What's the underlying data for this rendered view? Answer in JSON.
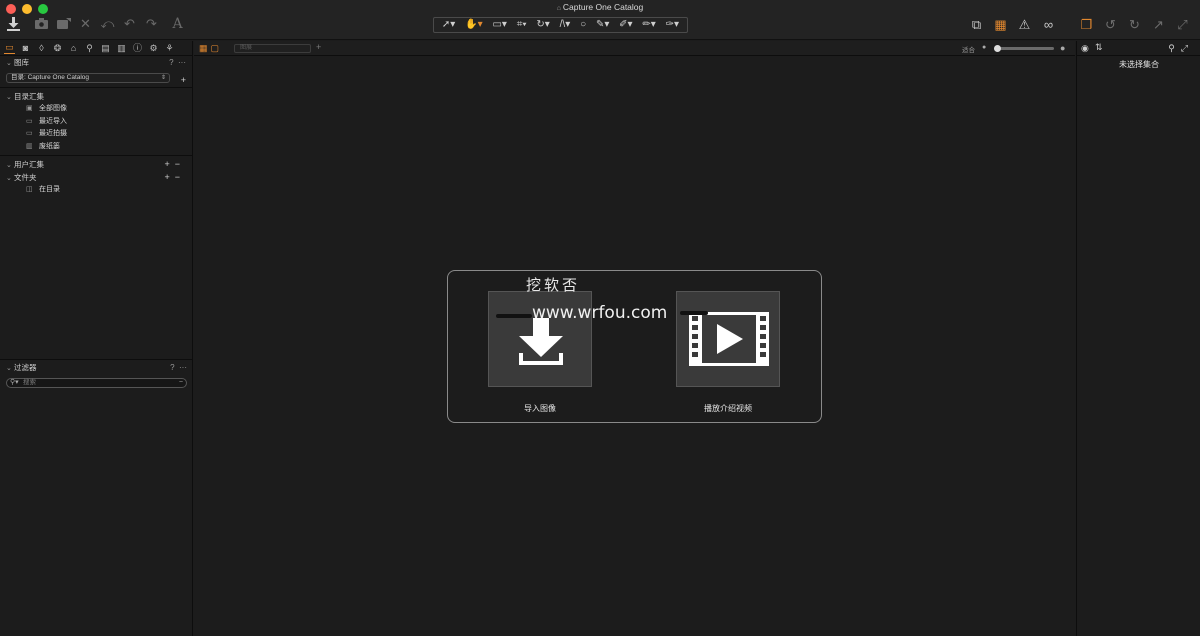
{
  "window": {
    "title": "Capture One Catalog"
  },
  "toolbar": {
    "text_tool": "A",
    "cursor_tools": [
      "pointer",
      "hand",
      "capture",
      "crop",
      "rotate",
      "keystone",
      "spot",
      "eyedropper",
      "brush",
      "eraser",
      "gradient"
    ]
  },
  "left_panel": {
    "tabs": [
      "library",
      "capture",
      "lens",
      "color",
      "exposure",
      "details",
      "local",
      "adjust",
      "metadata",
      "output",
      "batch"
    ],
    "library": {
      "title": "图库",
      "help": "?",
      "more": "···",
      "catalog_select": "目录: Capture One Catalog",
      "add": "+",
      "catalog_collections": {
        "title": "目录汇集",
        "items": [
          {
            "icon": "photos-icon",
            "label": "全部图像"
          },
          {
            "icon": "folder-icon",
            "label": "最近导入"
          },
          {
            "icon": "folder-icon",
            "label": "最近拍摄"
          },
          {
            "icon": "trash-icon",
            "label": "废纸篓"
          }
        ]
      },
      "user_collections": {
        "title": "用户汇集",
        "add": "+",
        "remove": "−"
      },
      "folders": {
        "title": "文件夹",
        "add": "+",
        "remove": "−",
        "items": [
          {
            "icon": "book-icon",
            "label": "在目录"
          }
        ]
      }
    },
    "filters": {
      "title": "过滤器",
      "help": "?",
      "more": "···",
      "search_placeholder": "搜索"
    }
  },
  "viewer_header": {
    "search_placeholder": "图展",
    "fit_label": "适合",
    "zoom_level": 0
  },
  "viewer": {
    "watermark_cn": "挖软否",
    "watermark_url": "www.wrfou.com",
    "import_label": "导入图像",
    "video_label": "播放介绍视频"
  },
  "right_panel": {
    "empty_text": "未选择集合"
  },
  "colors": {
    "accent": "#e2882f",
    "background": "#1c1c1c",
    "tile": "#3a3a3a"
  }
}
